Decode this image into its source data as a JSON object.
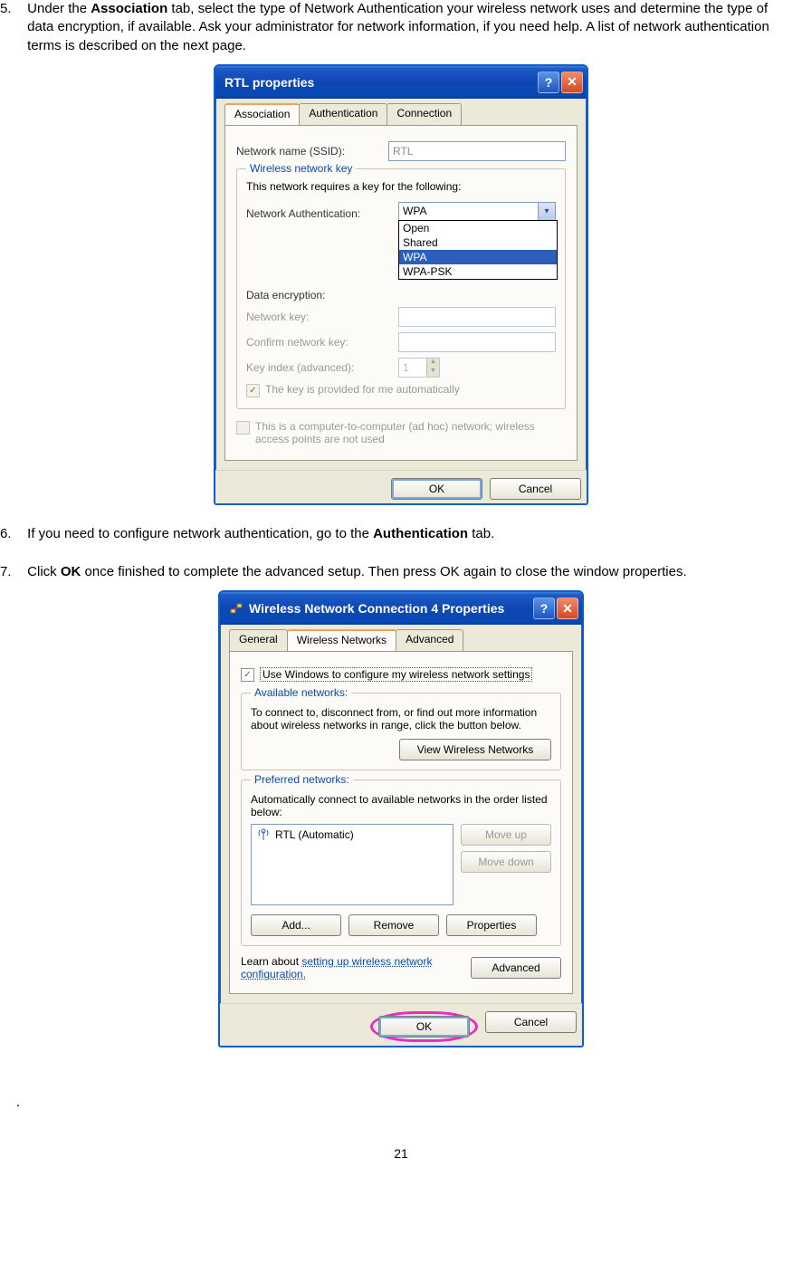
{
  "instructions": {
    "step5": {
      "num": "5.",
      "text_prefix": "Under the ",
      "bold1": "Association",
      "text_mid": " tab, select the type of Network Authentication your wireless network uses and determine the type of data encryption, if available.    Ask your administrator for network information, if you need help.    A list of network authentication terms is described on the next page."
    },
    "step6": {
      "num": "6.",
      "text_prefix": "If you need to configure network authentication, go to the ",
      "bold1": "Authentication",
      "text_suffix": " tab."
    },
    "step7": {
      "num": "7.",
      "text_prefix": "Click ",
      "bold1": "OK",
      "text_suffix": " once finished to complete the advanced setup.    Then press OK again to close the window properties."
    }
  },
  "dialog1": {
    "title": "RTL properties",
    "tabs": {
      "t1": "Association",
      "t2": "Authentication",
      "t3": "Connection"
    },
    "ssid_label": "Network name (SSID):",
    "ssid_value": "RTL",
    "group_title": "Wireless network key",
    "group_caption": "This network requires a key for the following:",
    "auth_label": "Network Authentication:",
    "auth_selected": "WPA",
    "auth_options": [
      "Open",
      "Shared",
      "WPA",
      "WPA-PSK"
    ],
    "enc_label": "Data encryption:",
    "netkey_label": "Network key:",
    "confirm_label": "Confirm network key:",
    "keyindex_label": "Key index (advanced):",
    "keyindex_value": "1",
    "auto_cb": "The key is provided for me automatically",
    "adhoc_cb": "This is a computer-to-computer (ad hoc) network; wireless access points are not used",
    "ok": "OK",
    "cancel": "Cancel"
  },
  "dialog2": {
    "title": "Wireless Network Connection 4 Properties",
    "tabs": {
      "t1": "General",
      "t2": "Wireless Networks",
      "t3": "Advanced"
    },
    "use_windows_cb": "Use Windows to configure my wireless network settings",
    "avail_title": "Available networks:",
    "avail_caption": "To connect to, disconnect from, or find out more information about wireless networks in range, click the button below.",
    "view_btn": "View Wireless Networks",
    "pref_title": "Preferred networks:",
    "pref_caption": "Automatically connect to available networks in the order listed below:",
    "pref_item": "RTL (Automatic)",
    "move_up": "Move up",
    "move_down": "Move down",
    "add": "Add...",
    "remove": "Remove",
    "properties": "Properties",
    "learn_text": "Learn about ",
    "learn_link": "setting up wireless network configuration.",
    "advanced": "Advanced",
    "ok": "OK",
    "cancel": "Cancel"
  },
  "dot_line": ".",
  "page_num": "21"
}
